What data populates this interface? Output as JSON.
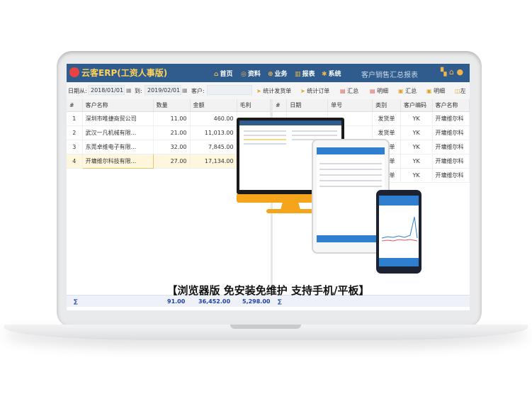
{
  "app": {
    "title": "云客ERP",
    "subtitle": "(工资人事版)",
    "report_title": "客户销售汇总报表",
    "accent": "#2f5c8c"
  },
  "nav": [
    {
      "label": "首页",
      "icon": "home-icon"
    },
    {
      "label": "资料",
      "icon": "data-icon"
    },
    {
      "label": "业务",
      "icon": "business-icon"
    },
    {
      "label": "报表",
      "icon": "report-icon"
    },
    {
      "label": "系统",
      "icon": "gear-icon"
    }
  ],
  "toolbar": {
    "date_from_label": "日期从:",
    "date_from": "2018/01/01",
    "date_to_label": "到:",
    "date_to": "2019/02/01",
    "customer_label": "客户:",
    "customer_value": "",
    "btn_ship": "统计发货单",
    "btn_order": "统计订单",
    "btn_summary1": "汇总",
    "btn_detail1": "明细",
    "btn_summary2": "汇总",
    "btn_detail2": "明细",
    "btn_left": "左"
  },
  "left_table": {
    "headers": [
      "#",
      "客户名称",
      "数量",
      "金额",
      "毛利"
    ],
    "rows": [
      {
        "idx": "1",
        "name": "深圳市唯捷商贸公司",
        "qty": "11.00",
        "amount": "460.00",
        "profit": ""
      },
      {
        "idx": "2",
        "name": "武汉一凡机械有限...",
        "qty": "21.00",
        "amount": "11,013.00",
        "profit": ""
      },
      {
        "idx": "3",
        "name": "东莞卓维电子有限...",
        "qty": "32.00",
        "amount": "7,845.00",
        "profit": ""
      },
      {
        "idx": "4",
        "name": "开墉维尔科技有限...",
        "qty": "27.00",
        "amount": "17,134.00",
        "profit": ""
      }
    ],
    "totals": {
      "sigma": "∑",
      "qty": "91.00",
      "amount": "36,452.00",
      "profit": "5,298.00"
    }
  },
  "right_table": {
    "headers": [
      "#",
      "日期",
      "单号",
      "类别",
      "客户编码",
      "客户名称"
    ],
    "rows": [
      {
        "type": "发货单",
        "code": "YK",
        "name": "开墉维尔科"
      },
      {
        "type": "发货单",
        "code": "YK",
        "name": "开墉维尔科"
      },
      {
        "type": "发货单",
        "code": "YK",
        "name": "开墉维尔科"
      },
      {
        "type": "发货单",
        "code": "YK",
        "name": "开墉维尔科"
      },
      {
        "type": "发货单",
        "code": "YK",
        "name": "开墉维尔科"
      }
    ],
    "totals": {
      "sigma": "∑"
    }
  },
  "caption": "【浏览器版 免安装免维护 支持手机/平板】"
}
